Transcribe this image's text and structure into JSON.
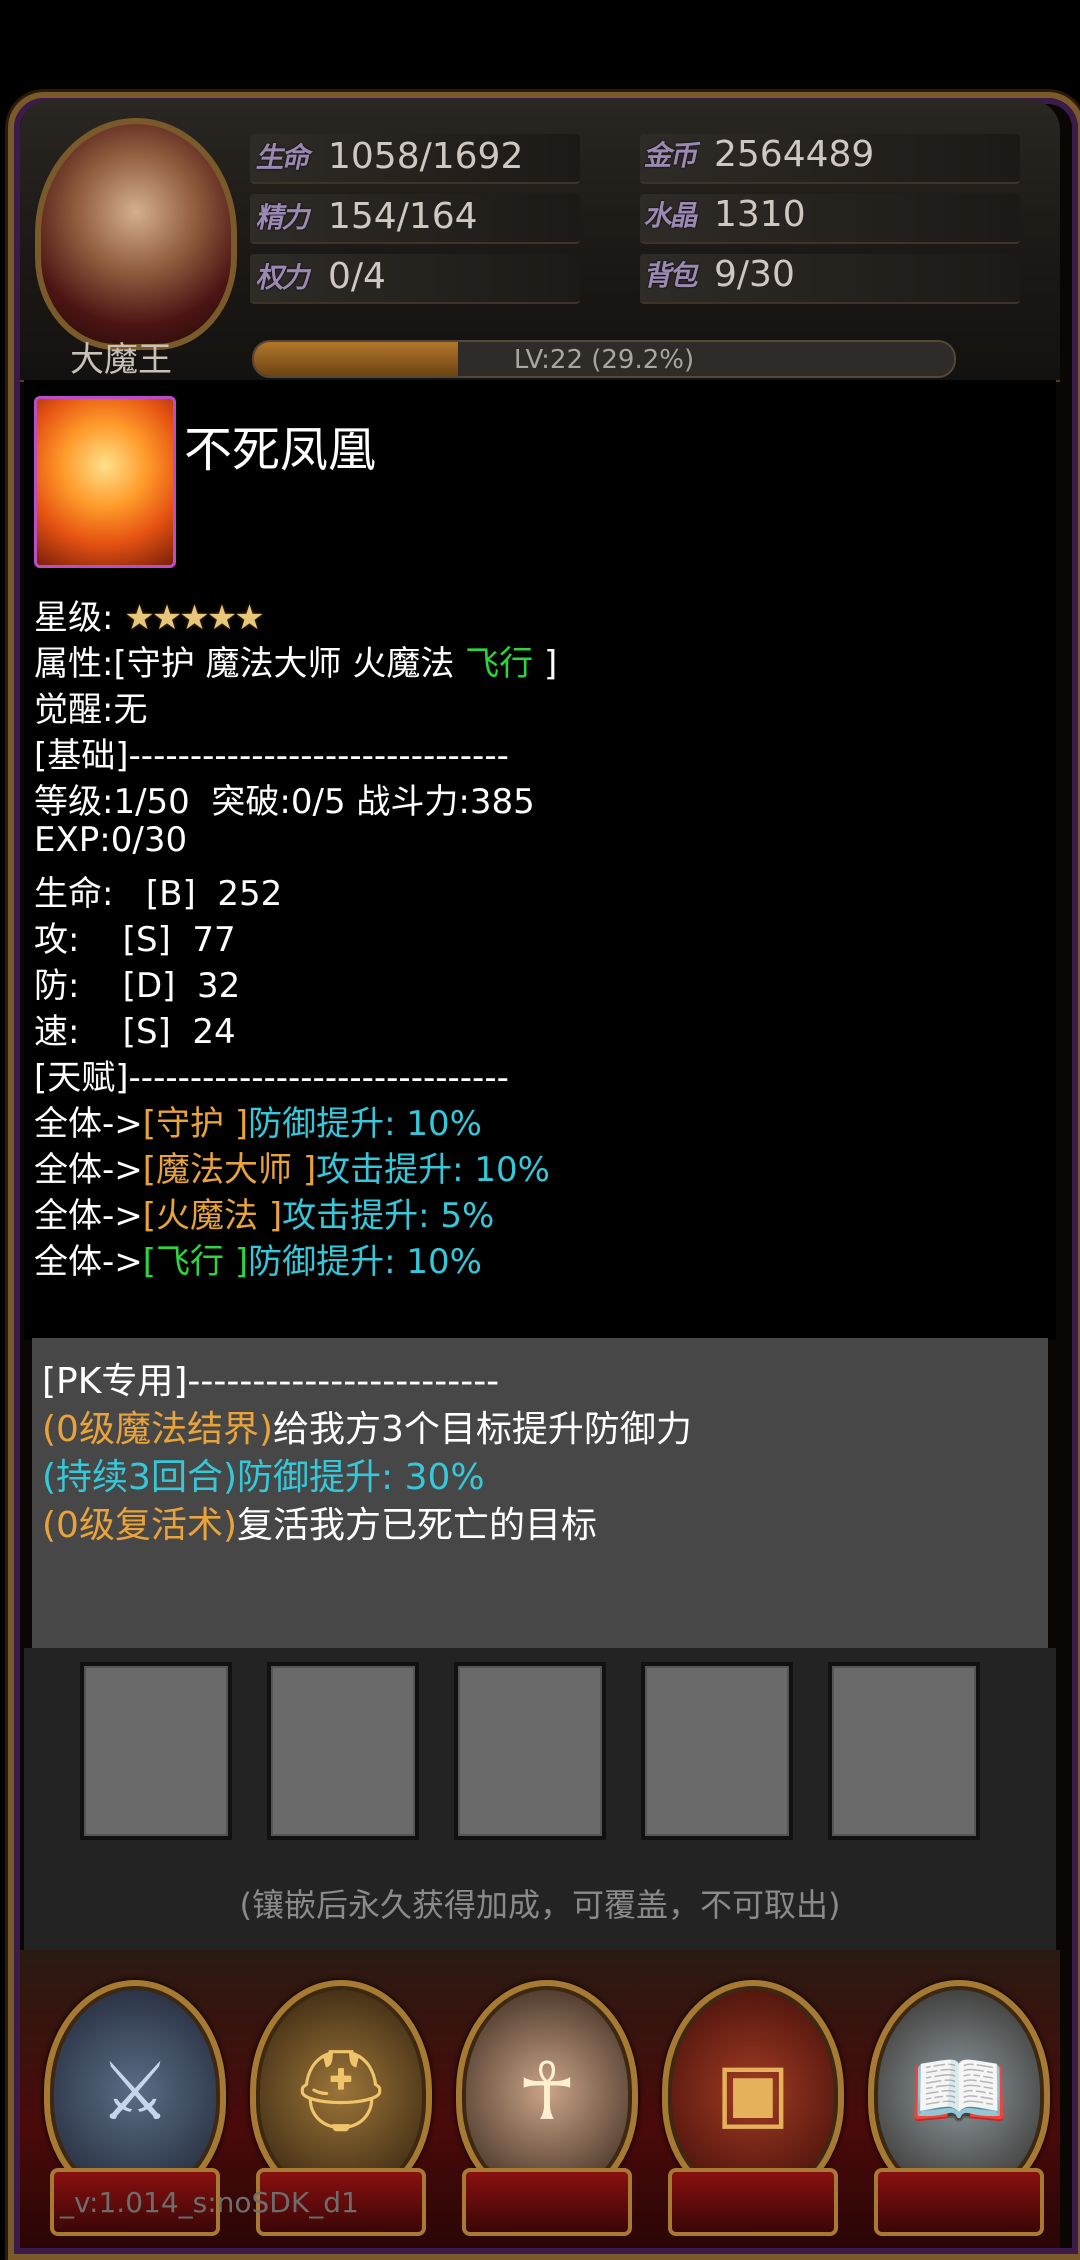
{
  "hud": {
    "hero_name": "大魔王",
    "stats_left": [
      {
        "icon": "生命",
        "value": "1058/1692"
      },
      {
        "icon": "精力",
        "value": "154/164"
      },
      {
        "icon": "权力",
        "value": "0/4"
      }
    ],
    "stats_right": [
      {
        "icon": "金币",
        "value": "2564489"
      },
      {
        "icon": "水晶",
        "value": "1310"
      },
      {
        "icon": "背包",
        "value": "9/30"
      }
    ],
    "level_text": "LV:22 (29.2%)",
    "level_progress": 0.292
  },
  "pet": {
    "name": "不死凤凰",
    "star_label": "星级:",
    "stars": "★★★★★",
    "attr_prefix": "属性:[守护 魔法大师 火魔法 ",
    "attr_fly": "飞行",
    "attr_suffix": " ]",
    "awaken": "觉醒:无",
    "basic_header": "[基础]-------------------------------",
    "level_line": "等级:1/50  突破:0/5 战斗力:385",
    "exp_line": "EXP:0/30",
    "hp_line": "生命:   [B]  252",
    "atk_line": "攻:    [S]  77",
    "def_line": "防:    [D]  32",
    "spd_line": "速:    [S]  24",
    "talent_header": "[天赋]-------------------------------",
    "talents": [
      {
        "prefix": "全体->",
        "tag": "[守护 ]",
        "tag_color": "orange",
        "effect": "防御提升: 10%"
      },
      {
        "prefix": "全体->",
        "tag": "[魔法大师 ]",
        "tag_color": "orange",
        "effect": "攻击提升: 10%"
      },
      {
        "prefix": "全体->",
        "tag": "[火魔法 ]",
        "tag_color": "orange",
        "effect": "攻击提升: 5%"
      },
      {
        "prefix": "全体->",
        "tag": "[飞行 ]",
        "tag_color": "green",
        "effect": "防御提升: 10%"
      }
    ]
  },
  "pk": {
    "header": "[PK专用]------------------------",
    "skill1_name": "(0级魔法结界)",
    "skill1_desc": "给我方3个目标提升防御力",
    "skill1_effect": "(持续3回合)防御提升: 30%",
    "skill2_name": "(0级复活术)",
    "skill2_desc": "复活我方已死亡的目标"
  },
  "inlay": {
    "slots": 5,
    "hint": "(镶嵌后永久获得加成，可覆盖，不可取出)"
  },
  "nav": {
    "buttons": [
      {
        "name": "shield-swords-icon",
        "glyph": "⚔"
      },
      {
        "name": "golden-helmet-icon",
        "glyph": "⛑"
      },
      {
        "name": "sage-icon",
        "glyph": "☥"
      },
      {
        "name": "treasure-chest-icon",
        "glyph": "▣"
      },
      {
        "name": "book-icon",
        "glyph": "📖"
      }
    ]
  },
  "version": "_v:1.014_s:noSDK_d1",
  "colors": {
    "orange": "#e8a33b",
    "green": "#2bd640",
    "cyan": "#35c8da",
    "frame_gold": "#7a5a2a",
    "panel_gray": "#474747"
  }
}
